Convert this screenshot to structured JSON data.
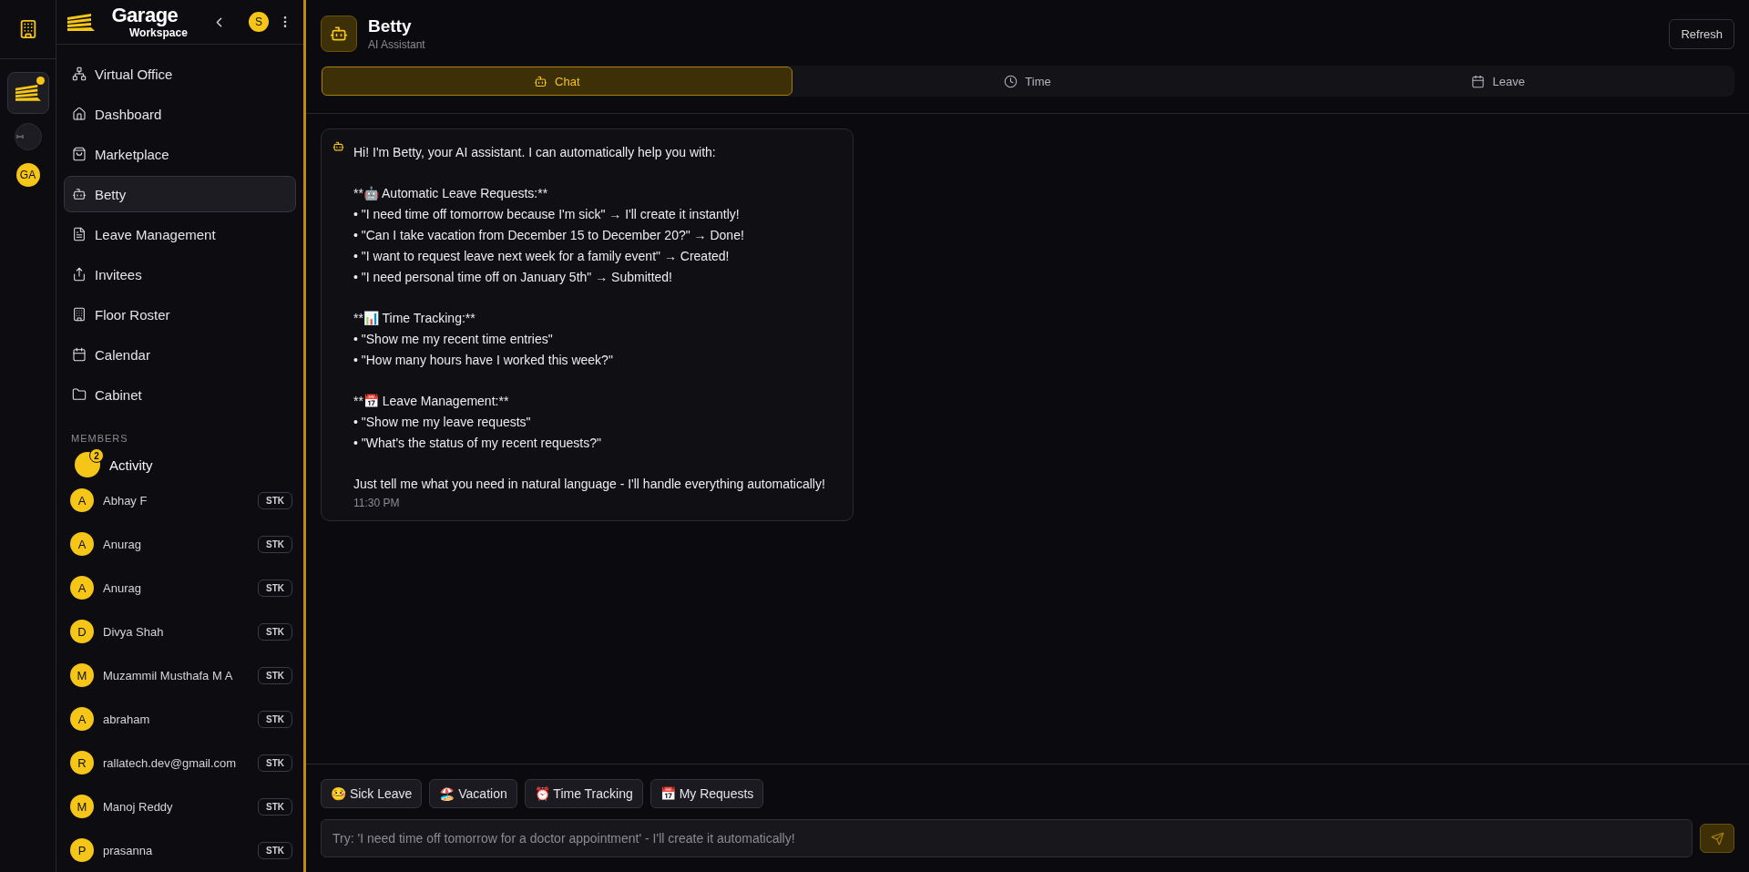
{
  "rail": {
    "avatar_initials": "GA",
    "workspace_notification": true
  },
  "sidebar": {
    "brand": {
      "name": "Garage",
      "subtitle": "Workspace"
    },
    "user_initial": "S",
    "nav": [
      {
        "label": "Virtual Office",
        "selected": false
      },
      {
        "label": "Dashboard",
        "selected": false
      },
      {
        "label": "Marketplace",
        "selected": false
      },
      {
        "label": "Betty",
        "selected": true
      },
      {
        "label": "Leave Management",
        "selected": false
      },
      {
        "label": "Invitees",
        "selected": false
      },
      {
        "label": "Floor Roster",
        "selected": false
      },
      {
        "label": "Calendar",
        "selected": false
      },
      {
        "label": "Cabinet",
        "selected": false
      }
    ],
    "members_heading": "MEMBERS",
    "activity": {
      "label": "Activity",
      "count": "2"
    },
    "members": [
      {
        "initial": "A",
        "name": "Abhay F",
        "tag": "STK"
      },
      {
        "initial": "A",
        "name": "Anurag",
        "tag": "STK"
      },
      {
        "initial": "A",
        "name": "Anurag",
        "tag": "STK"
      },
      {
        "initial": "D",
        "name": "Divya Shah",
        "tag": "STK"
      },
      {
        "initial": "M",
        "name": "Muzammil Musthafa M A",
        "tag": "STK"
      },
      {
        "initial": "A",
        "name": "abraham",
        "tag": "STK"
      },
      {
        "initial": "R",
        "name": "rallatech.dev@gmail.com",
        "tag": "STK"
      },
      {
        "initial": "M",
        "name": "Manoj Reddy",
        "tag": "STK"
      },
      {
        "initial": "P",
        "name": "prasanna",
        "tag": "STK"
      }
    ]
  },
  "header": {
    "title": "Betty",
    "subtitle": "AI Assistant",
    "refresh": "Refresh"
  },
  "tabs": [
    {
      "label": "Chat",
      "selected": true
    },
    {
      "label": "Time",
      "selected": false
    },
    {
      "label": "Leave",
      "selected": false
    }
  ],
  "message": {
    "paragraphs": [
      [
        "Hi! I'm Betty, your AI assistant. I can automatically help you with:"
      ],
      [
        "**🤖 Automatic Leave Requests:**",
        "• \"I need time off tomorrow because I'm sick\" → I'll create it instantly!",
        "• \"Can I take vacation from December 15 to December 20?\" → Done!",
        "• \"I want to request leave next week for a family event\" → Created!",
        "• \"I need personal time off on January 5th\" → Submitted!"
      ],
      [
        "**📊 Time Tracking:**",
        "• \"Show me my recent time entries\"",
        "• \"How many hours have I worked this week?\""
      ],
      [
        "**📅 Leave Management:**",
        "• \"Show me my leave requests\"",
        "• \"What's the status of my recent requests?\""
      ],
      [
        "Just tell me what you need in natural language - I'll handle everything automatically!"
      ]
    ],
    "time": "11:30 PM"
  },
  "quick_actions": [
    "🤒 Sick Leave",
    "🏖️ Vacation",
    "⏰ Time Tracking",
    "📅 My Requests"
  ],
  "composer": {
    "placeholder": "Try: 'I need time off tomorrow for a doctor appointment' - I'll create it automatically!"
  }
}
